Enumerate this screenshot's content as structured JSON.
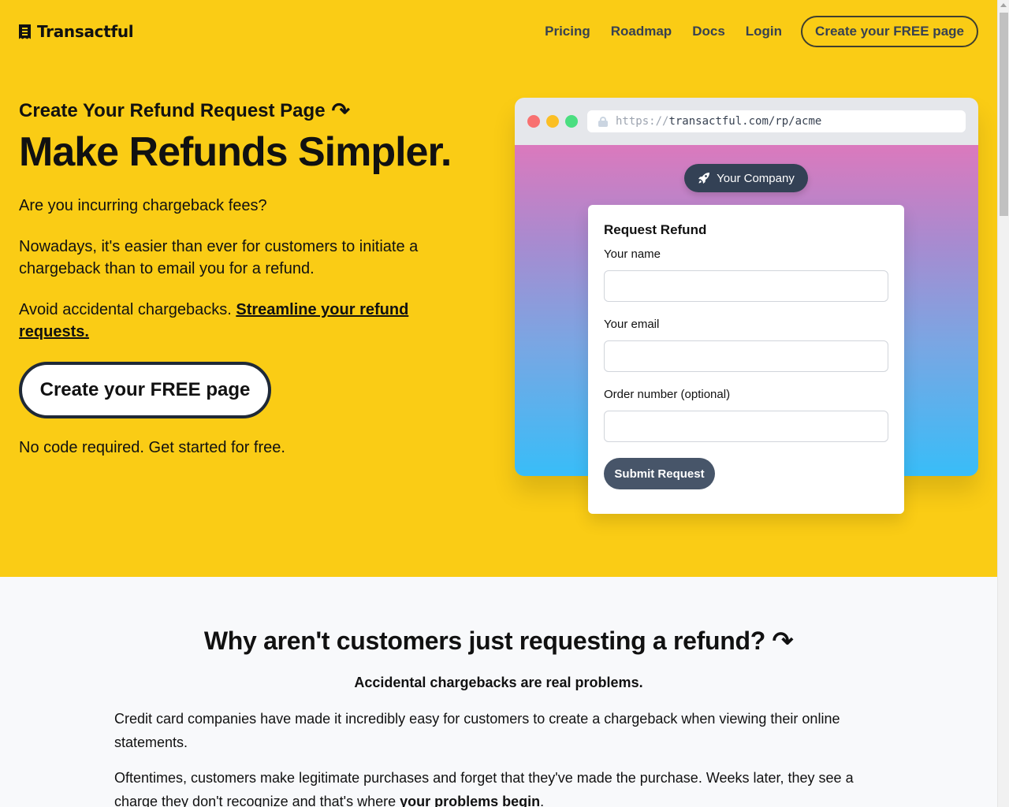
{
  "nav": {
    "brand": "Transactful",
    "logo_icon": "receipt-icon",
    "links": [
      "Pricing",
      "Roadmap",
      "Docs",
      "Login"
    ],
    "cta": "Create your FREE page"
  },
  "hero": {
    "eyebrow": "Create Your Refund Request Page",
    "eyebrow_icon": "curved-arrow-down-icon",
    "eyebrow_arrow_glyph": "↷",
    "headline": "Make Refunds Simpler.",
    "p1": "Are you incurring chargeback fees?",
    "p2": "Nowadays, it's easier than ever for customers to initiate a chargeback than to email you for a refund.",
    "p3_text": "Avoid accidental chargebacks. ",
    "p3_link": "Streamline your refund requests.",
    "cta": "Create your FREE page",
    "note": "No code required. Get started for free."
  },
  "browser_mock": {
    "url_protocol": "https://",
    "url_rest": "transactful.com/rp/acme",
    "company_pill": "Your Company",
    "company_icon": "rocket-icon",
    "form": {
      "title": "Request Refund",
      "fields": [
        {
          "label": "Your name",
          "value": "",
          "placeholder": ""
        },
        {
          "label": "Your email",
          "value": "",
          "placeholder": ""
        },
        {
          "label": "Order number (optional)",
          "value": "",
          "placeholder": ""
        }
      ],
      "submit": "Submit Request"
    }
  },
  "section2": {
    "title": "Why aren't customers just requesting a refund?",
    "title_arrow_glyph": "↷",
    "subtitle": "Accidental chargebacks are real problems.",
    "p1": "Credit card companies have made it incredibly easy for customers to create a chargeback when viewing their online statements.",
    "p2_text": "Oftentimes, customers make legitimate purchases and forget that they've made the purchase. Weeks later, they see a charge they don't recognize and that's where ",
    "p2_link": "your problems begin",
    "p2_end": "."
  },
  "colors": {
    "hero_bg": "#facc15",
    "section_bg": "#f8f9fb",
    "pill_bg": "#334155",
    "submit_bg": "#475569",
    "gradient_top": "#db79bd",
    "gradient_bottom": "#38bdf8"
  }
}
